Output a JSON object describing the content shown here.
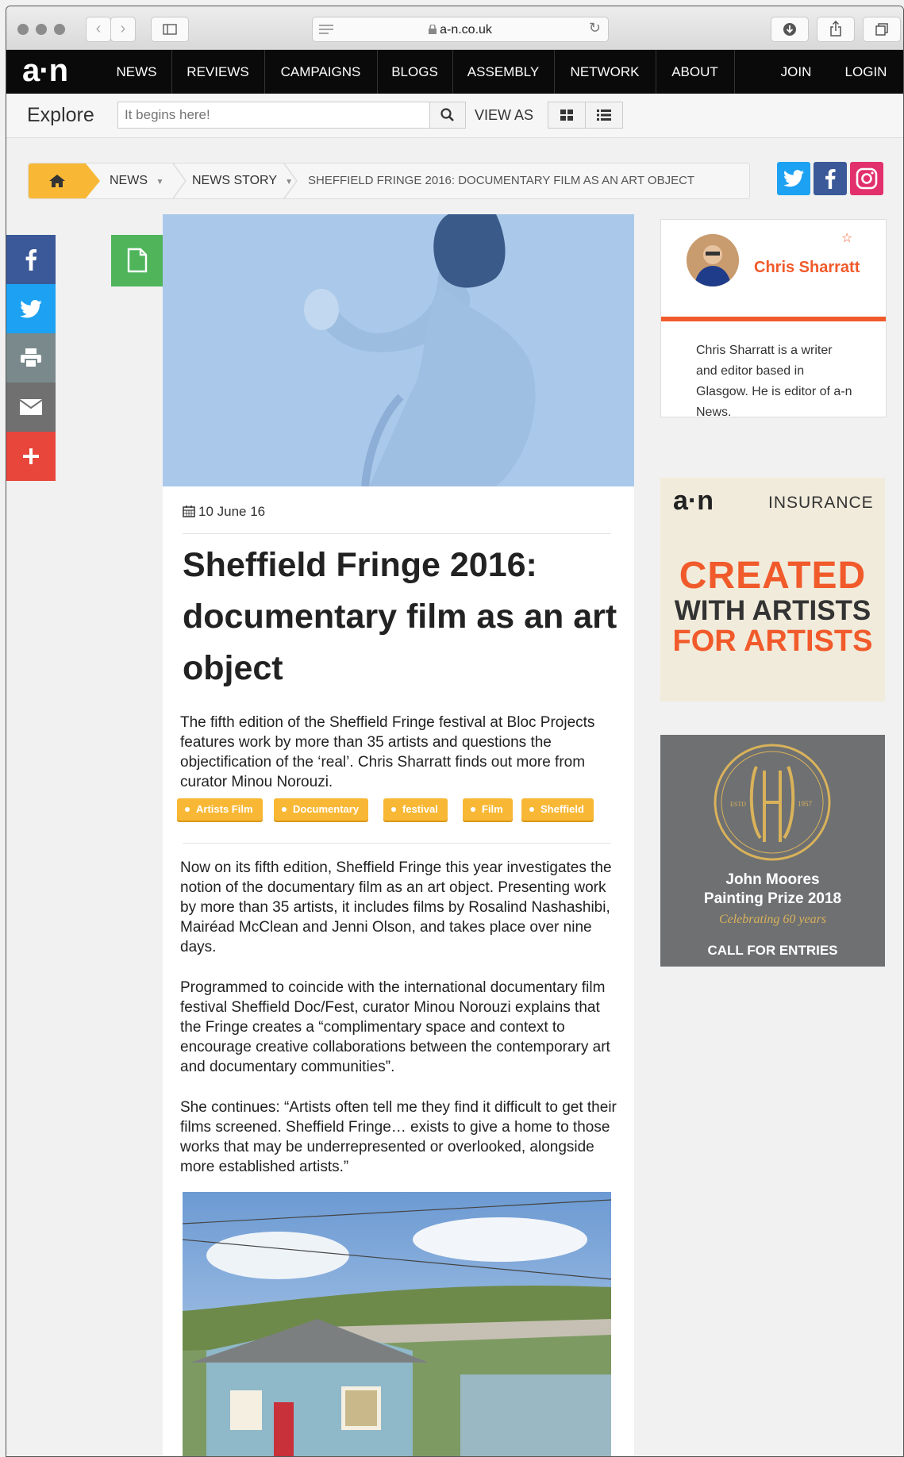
{
  "browser": {
    "url": "a-n.co.uk"
  },
  "site": {
    "logo": "a·n",
    "nav": [
      "NEWS",
      "REVIEWS",
      "CAMPAIGNS",
      "BLOGS",
      "ASSEMBLY",
      "NETWORK",
      "ABOUT"
    ],
    "join": "JOIN",
    "login": "LOGIN"
  },
  "explore": {
    "label": "Explore",
    "search_placeholder": "It begins here!",
    "view_as": "VIEW AS"
  },
  "breadcrumb": {
    "items": [
      "NEWS",
      "NEWS STORY",
      "SHEFFIELD FRINGE 2016: DOCUMENTARY FILM AS AN ART OBJECT"
    ]
  },
  "article": {
    "date": "10 June 16",
    "title": "Sheffield Fringe 2016: documentary film as an art object",
    "lead": "The fifth edition of the Sheffield Fringe festival at Bloc Projects features work by more than 35 artists and questions the objectification of the ‘real’. Chris Sharratt finds out more from curator Minou Norouzi.",
    "tags": [
      "Artists Film",
      "Documentary",
      "festival",
      "Film",
      "Sheffield"
    ],
    "paragraphs": [
      "Now on its fifth edition, Sheffield Fringe this year investigates the notion of the documentary film as an art object. Presenting work by more than 35 artists, it includes films by Rosalind Nashashibi, Mairéad McClean and Jenni Olson, and takes place over nine days.",
      "Programmed to coincide with the international documentary film festival Sheffield Doc/Fest, curator Minou Norouzi explains that the Fringe creates a “complimentary space and context to encourage creative collaborations between the contemporary art and documentary communities”.",
      "She continues: “Artists often tell me they find it difficult to get their films screened. Sheffield Fringe… exists to give a home to those works that may be underrepresented or overlooked, alongside more established artists.”"
    ]
  },
  "author": {
    "name": "Chris Sharratt",
    "bio": "Chris Sharratt is a writer and editor based in Glasgow. He is editor of a-n News."
  },
  "ad_insurance": {
    "logo": "a·n",
    "label": "INSURANCE",
    "line1": "CREATED",
    "line2": "WITH ARTISTS",
    "line3": "FOR ARTISTS"
  },
  "ad_moores": {
    "estd": "ESTD",
    "year": "1957",
    "line1": "John Moores",
    "line2": "Painting Prize 2018",
    "line3": "Celebrating 60 years",
    "line4": "CALL FOR ENTRIES"
  },
  "colors": {
    "accent": "#f15a2b",
    "tag": "#f8b836",
    "facebook": "#3b5998",
    "twitter": "#1da1f2",
    "instagram": "#e1306c"
  }
}
